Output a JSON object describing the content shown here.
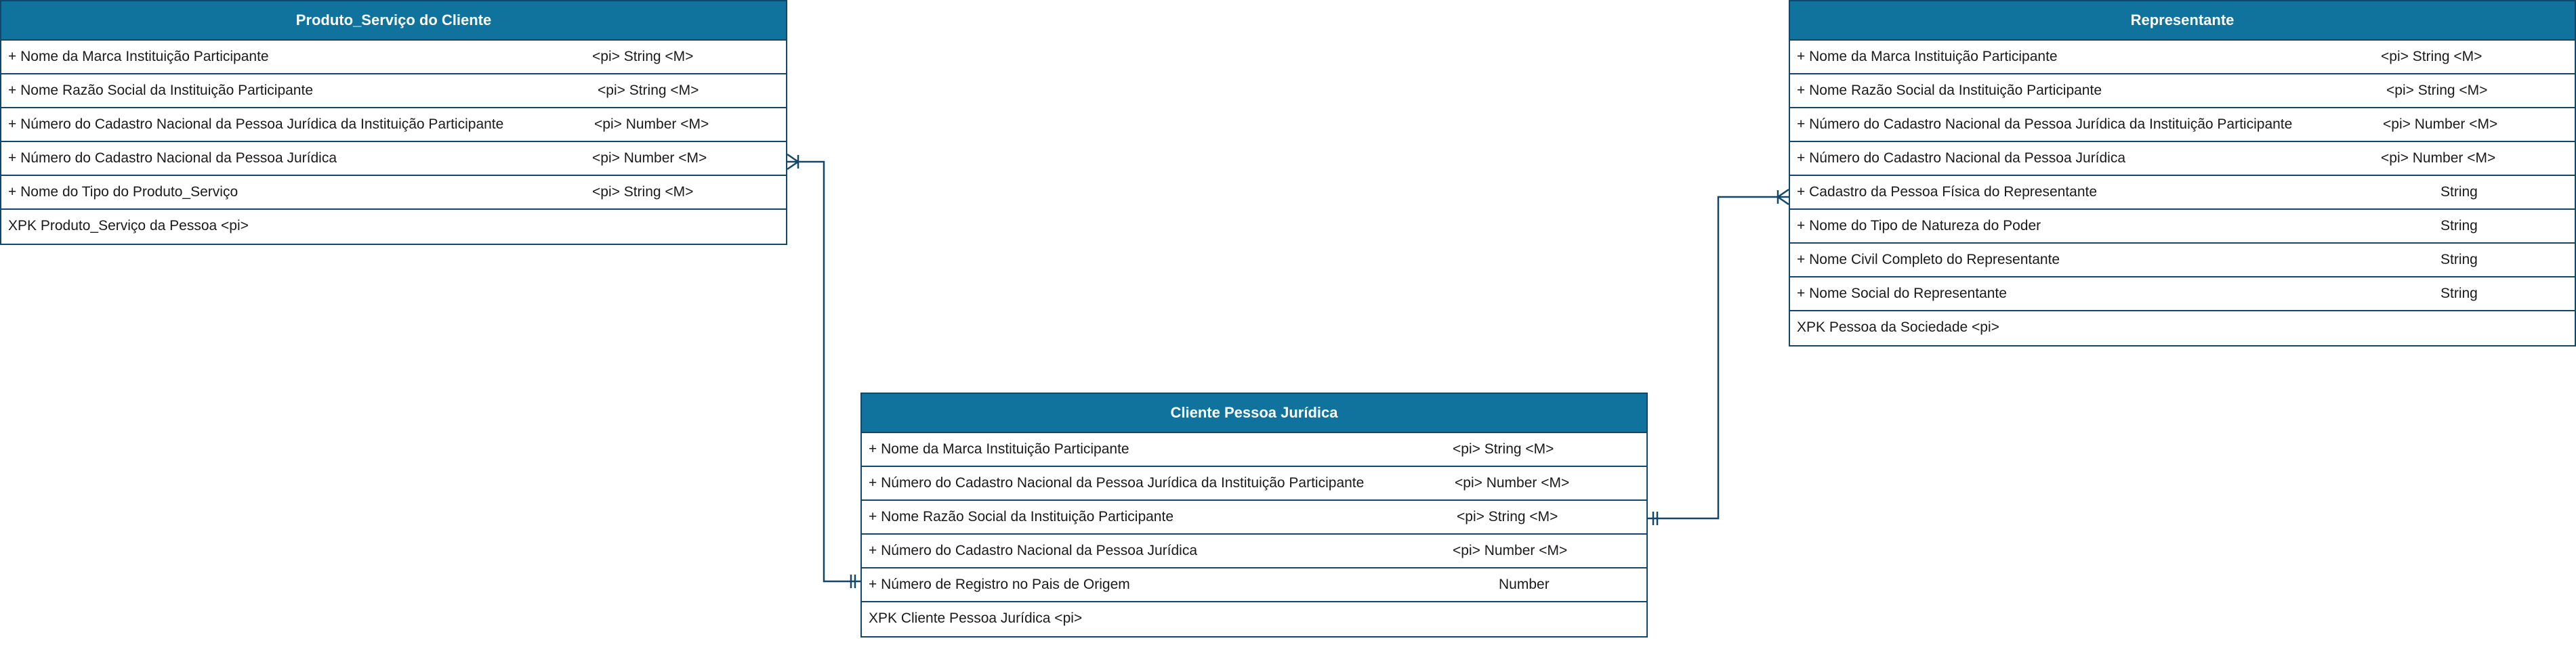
{
  "entities": [
    {
      "id": "produto",
      "title": "Produto_Serviço do Cliente",
      "rows": [
        {
          "name": "+ Nome da Marca Instituição Participante",
          "meta": "<pi> String     <M>"
        },
        {
          "name": "+ Nome Razão Social da Instituição Participante",
          "meta": "<pi> String     <M>"
        },
        {
          "name": "+ Número do Cadastro Nacional da Pessoa Jurídica da Instituição Participante",
          "meta": "<pi> Number  <M>"
        },
        {
          "name": "+ Número do Cadastro Nacional  da Pessoa Jurídica",
          "meta": "<pi> Number <M>"
        },
        {
          "name": "+ Nome do Tipo do  Produto_Serviço",
          "meta": "<pi>  String     <M>"
        },
        {
          "name": "XPK Produto_Serviço da Pessoa  <pi>",
          "meta": ""
        }
      ]
    },
    {
      "id": "cliente",
      "title": "Cliente Pessoa Jurídica",
      "rows": [
        {
          "name": "+ Nome da Marca Instituição Participante",
          "meta": "<pi> String     <M>"
        },
        {
          "name": "+ Número do Cadastro Nacional da Pessoa Jurídica da Instituição Participante",
          "meta": "<pi> Number  <M>"
        },
        {
          "name": "+ Nome Razão Social da Instituição Participante",
          "meta": "<pi> String     <M>"
        },
        {
          "name": "+ Número do Cadastro Nacional da Pessoa Jurídica",
          "meta": "<pi> Number <M>"
        },
        {
          "name": "+ Número de Registro no Pais de Origem",
          "meta": "Number"
        },
        {
          "name": "XPK Cliente Pessoa Jurídica <pi>",
          "meta": ""
        }
      ]
    },
    {
      "id": "representante",
      "title": "Representante",
      "rows": [
        {
          "name": "+ Nome da Marca Instituição Participante",
          "meta": "<pi> String     <M>"
        },
        {
          "name": "+ Nome Razão Social da Instituição Participante",
          "meta": "<pi> String     <M>"
        },
        {
          "name": "+ Número do Cadastro Nacional da Pessoa Jurídica da Instituição Participante",
          "meta": "<pi> Number  <M>"
        },
        {
          "name": "+ Número do Cadastro Nacional  da Pessoa Jurídica",
          "meta": "<pi> Number <M>"
        },
        {
          "name": "+ Cadastro da Pessoa Física do Representante",
          "meta": "String"
        },
        {
          "name": "+ Nome do Tipo de Natureza do Poder",
          "meta": "String"
        },
        {
          "name": "+ Nome Civil Completo do Representante",
          "meta": "String"
        },
        {
          "name": "+ Nome Social do Representante",
          "meta": "String"
        },
        {
          "name": "XPK Pessoa da Sociedade  <pi>",
          "meta": ""
        }
      ]
    }
  ],
  "relationships": [
    {
      "from": "produto",
      "to": "cliente",
      "from_cardinality": "one-or-many",
      "to_cardinality": "exactly-one"
    },
    {
      "from": "representante",
      "to": "cliente",
      "from_cardinality": "one-or-many",
      "to_cardinality": "exactly-one"
    }
  ],
  "colors": {
    "header_bg": "#10739e",
    "border": "#10476b",
    "header_text": "#ffffff",
    "text": "#1a1a1a"
  }
}
